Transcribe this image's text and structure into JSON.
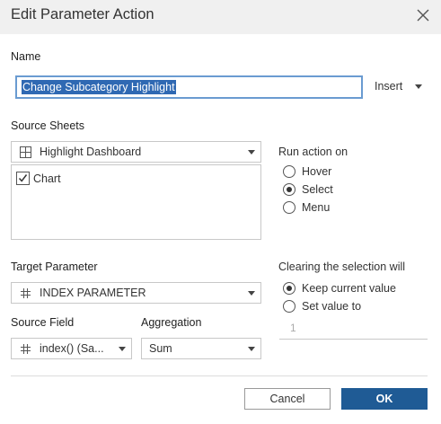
{
  "dialog": {
    "title": "Edit Parameter Action"
  },
  "name_section": {
    "label": "Name",
    "value": "Change Subcategory Highlight",
    "insert_label": "Insert"
  },
  "source_sheets": {
    "label": "Source Sheets",
    "selected_sheet": "Highlight Dashboard",
    "items": [
      {
        "label": "Chart",
        "checked": true
      }
    ]
  },
  "run_action_on": {
    "label": "Run action on",
    "options": [
      {
        "label": "Hover",
        "selected": false
      },
      {
        "label": "Select",
        "selected": true
      },
      {
        "label": "Menu",
        "selected": false
      }
    ]
  },
  "target_parameter": {
    "label": "Target Parameter",
    "value": "INDEX PARAMETER"
  },
  "source_field": {
    "label": "Source Field",
    "value": "index() (Sa..."
  },
  "aggregation": {
    "label": "Aggregation",
    "value": "Sum"
  },
  "clearing": {
    "label": "Clearing the selection will",
    "options": [
      {
        "label": "Keep current value",
        "selected": true
      },
      {
        "label": "Set value to",
        "selected": false
      }
    ],
    "value_placeholder": "1"
  },
  "buttons": {
    "cancel": "Cancel",
    "ok": "OK"
  },
  "colors": {
    "accent": "#1f5b95",
    "selection": "#2f69b3",
    "focus_border": "#6a9bd1"
  },
  "icons": {
    "close": "close-icon",
    "sheet": "dashboard-grid-icon",
    "field": "hash-icon"
  }
}
